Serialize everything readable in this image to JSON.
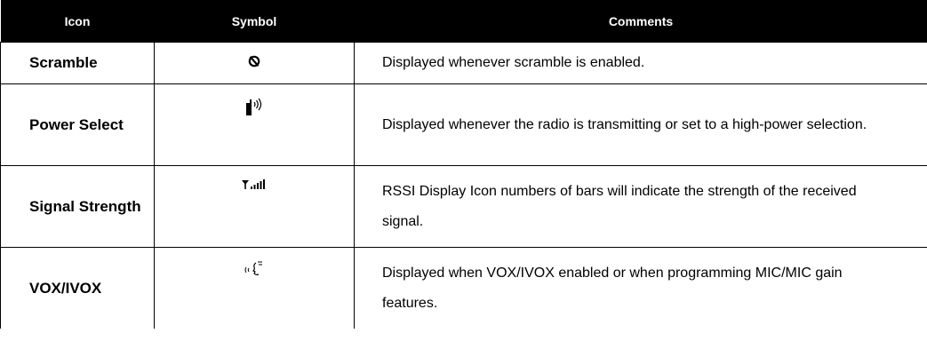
{
  "table": {
    "headers": [
      "Icon",
      "Symbol",
      "Comments"
    ],
    "rows": [
      {
        "icon": "Scramble",
        "symbol_icon": "scramble-icon",
        "comment": "Displayed whenever scramble is enabled."
      },
      {
        "icon": "Power Select",
        "symbol_icon": "power-select-icon",
        "comment": "Displayed whenever the radio is transmitting or set to a high-power selection."
      },
      {
        "icon": "Signal Strength",
        "symbol_icon": "signal-strength-icon",
        "comment": "RSSI Display Icon numbers of bars will indicate the strength of the received signal."
      },
      {
        "icon": "VOX/IVOX",
        "symbol_icon": "vox-icon",
        "comment": "Displayed when VOX/IVOX enabled or when programming MIC/MIC gain features."
      }
    ]
  }
}
